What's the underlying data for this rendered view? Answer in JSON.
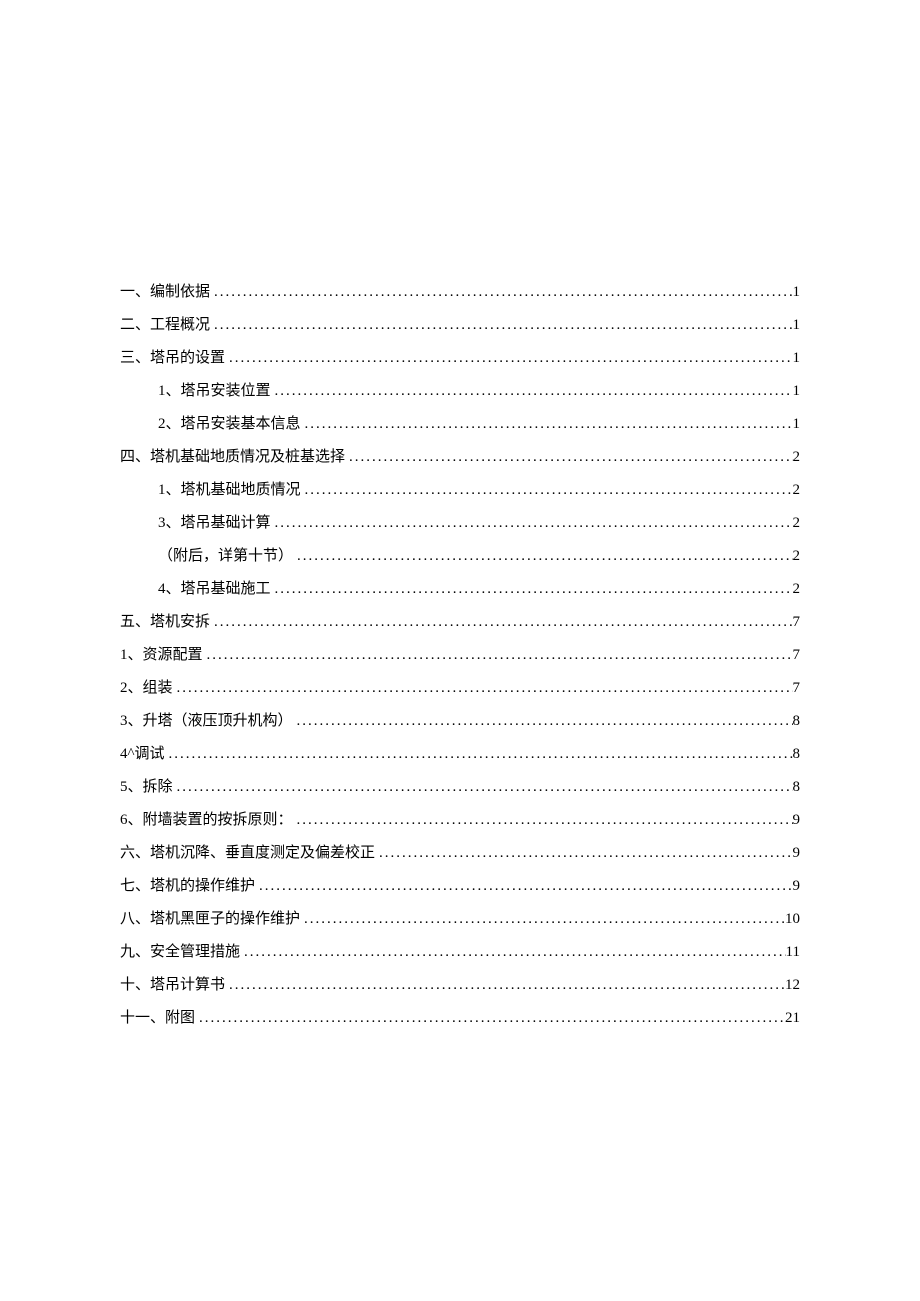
{
  "toc": [
    {
      "label": "一、编制依据",
      "page": "1",
      "indent": 0
    },
    {
      "label": "二、工程概况",
      "page": "1",
      "indent": 0
    },
    {
      "label": "三、塔吊的设置",
      "page": "1",
      "indent": 0
    },
    {
      "label": "1、塔吊安装位置",
      "page": "1",
      "indent": 1
    },
    {
      "label": "2、塔吊安装基本信息",
      "page": "1",
      "indent": 1
    },
    {
      "label": "四、塔机基础地质情况及桩基选择",
      "page": "2",
      "indent": 0
    },
    {
      "label": "1、塔机基础地质情况",
      "page": "2",
      "indent": 1
    },
    {
      "label": "3、塔吊基础计算",
      "page": "2",
      "indent": 1
    },
    {
      "label": "（附后，详第十节）",
      "page": "2",
      "indent": 1
    },
    {
      "label": "4、塔吊基础施工",
      "page": "2",
      "indent": 1
    },
    {
      "label": "五、塔机安拆",
      "page": "7",
      "indent": 0
    },
    {
      "label": "1、资源配置",
      "page": "7",
      "indent": 0
    },
    {
      "label": "2、组装",
      "page": "7",
      "indent": 0
    },
    {
      "label": "3、升塔（液压顶升机构）",
      "page": "8",
      "indent": 0
    },
    {
      "label": "4^调试",
      "page": "8",
      "indent": 0
    },
    {
      "label": "5、拆除",
      "page": "8",
      "indent": 0
    },
    {
      "label": "6、附墙装置的按拆原则：",
      "page": "9",
      "indent": 0
    },
    {
      "label": "六、塔机沉降、垂直度测定及偏差校正",
      "page": "9",
      "indent": 0
    },
    {
      "label": "七、塔机的操作维护",
      "page": "9",
      "indent": 0
    },
    {
      "label": "八、塔机黑匣子的操作维护",
      "page": "10",
      "indent": 0
    },
    {
      "label": "九、安全管理措施",
      "page": "11",
      "indent": 0
    },
    {
      "label": "十、塔吊计算书",
      "page": "12",
      "indent": 0
    },
    {
      "label": "十一、附图",
      "page": "21",
      "indent": 0
    }
  ]
}
